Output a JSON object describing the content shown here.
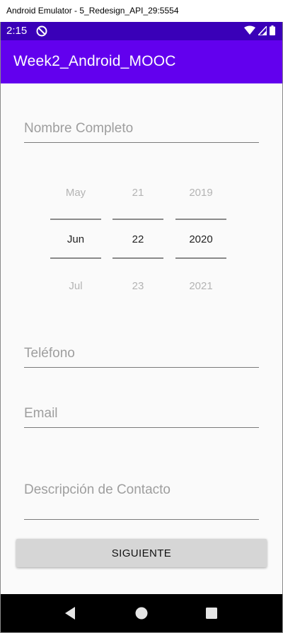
{
  "window": {
    "title": "Android Emulator - 5_Redesign_API_29:5554"
  },
  "status_bar": {
    "time": "2:15",
    "icons": [
      "dnd-icon",
      "wifi-icon",
      "signal-icon",
      "battery-icon"
    ]
  },
  "app_bar": {
    "title": "Week2_Android_MOOC"
  },
  "form": {
    "name_placeholder": "Nombre Completo",
    "date_picker": {
      "month": {
        "prev": "May",
        "selected": "Jun",
        "next": "Jul"
      },
      "day": {
        "prev": "21",
        "selected": "22",
        "next": "23"
      },
      "year": {
        "prev": "2019",
        "selected": "2020",
        "next": "2021"
      }
    },
    "phone_placeholder": "Teléfono",
    "email_placeholder": "Email",
    "description_placeholder": "Descripción de Contacto",
    "submit_label": "SIGUIENTE"
  },
  "nav_bar": {
    "icons": [
      "back-icon",
      "home-icon",
      "recents-icon"
    ]
  },
  "colors": {
    "status_bar": "#3a00b8",
    "app_bar": "#6200ee",
    "button": "#d6d6d6"
  }
}
